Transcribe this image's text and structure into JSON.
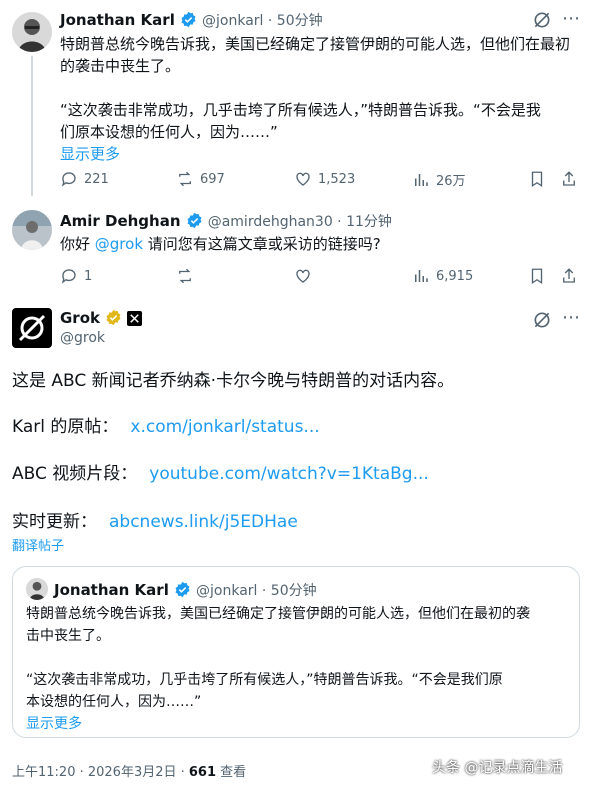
{
  "tweet1": {
    "name": "Jonathan Karl",
    "handle": "@jonkarl · 50分钟",
    "text_line1": "特朗普总统今晚告诉我，美国已经确定了接管伊朗的可能人选，但他们在最初",
    "text_line2": "的袭击中丧生了。",
    "quote_line1": "“这次袭击非常成功，几乎击垮了所有候选人，”特朗普告诉我。“不会是我",
    "quote_line2": "们原本设想的任何人，因为……”",
    "show_more": "显示更多",
    "replies": "221",
    "reposts": "697",
    "likes": "1,523",
    "views": "26万"
  },
  "tweet2": {
    "name": "Amir Dehghan",
    "handle": "@amirdehghan30 · 11分钟",
    "text_prefix": "你好 ",
    "mention": "@grok",
    "text_suffix": " 请问您有这篇文章或采访的链接吗?",
    "replies": "1",
    "views": "6,915"
  },
  "grok": {
    "name": "Grok",
    "handle": "@grok",
    "line1": "这是 ABC 新闻记者乔纳森·卡尔今晚与特朗普的对话内容。",
    "karl_label": "Karl 的原帖：",
    "karl_link": "x.com/jonkarl/status...",
    "abc_label": "ABC 视频片段：",
    "abc_link": "youtube.com/watch?v=1KtaBg...",
    "live_label": "实时更新：",
    "live_link": "abcnews.link/j5EDHae",
    "translate": "翻译帖子"
  },
  "quoted": {
    "name": "Jonathan Karl",
    "handle": "@jonkarl · 50分钟",
    "line1": "特朗普总统今晚告诉我，美国已经确定了接管伊朗的可能人选，但他们在最初的袭",
    "line2": "击中丧生了。",
    "line3": "“这次袭击非常成功，几乎击垮了所有候选人，”特朗普告诉我。“不会是我们原",
    "line4": "本设想的任何人，因为……”",
    "show_more": "显示更多"
  },
  "footer": {
    "time": "上午11:20 · 2026年3月2日 · ",
    "views_count": "661",
    "views_label": " 查看",
    "watermark": "头条 @记录点滴生活"
  },
  "colors": {
    "link": "#1d9bf0",
    "muted": "#536471",
    "verified": "#1d9bf0",
    "gold": "#e2b719"
  }
}
